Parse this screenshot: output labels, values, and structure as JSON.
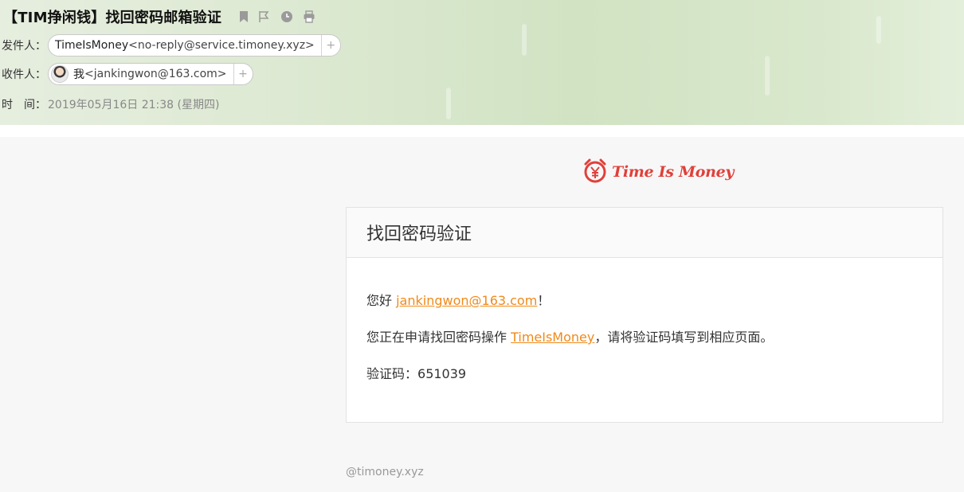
{
  "header": {
    "subject": "【TIM挣闲钱】找回密码邮箱验证",
    "sender_label": "发件人：",
    "sender_name": "TimeIsMoney",
    "sender_address": "<no-reply@service.timoney.xyz>",
    "recipient_label": "收件人：",
    "recipient_name": "我",
    "recipient_address": "<jankingwon@163.com>",
    "time_label": "时　间：",
    "time_value": "2019年05月16日 21:38 (星期四)",
    "add_symbol": "+",
    "icons": [
      "bookmark-icon",
      "flag-icon",
      "clock-icon",
      "print-icon"
    ]
  },
  "body": {
    "logo_text": "Time Is Money",
    "card_title": "找回密码验证",
    "greeting_prefix": "您好 ",
    "greeting_email": "jankingwon@163.com",
    "greeting_suffix": "！",
    "line2_prefix": "您正在申请找回密码操作 ",
    "line2_link": "TimeIsMoney",
    "line2_suffix": "，请将验证码填写到相应页面。",
    "code_label": "验证码：",
    "code_value": "651039",
    "footer": "@timoney.xyz"
  },
  "colors": {
    "accent_orange": "#f08a1a",
    "logo_red": "#e0403a",
    "header_green": "#d6e6c9"
  }
}
